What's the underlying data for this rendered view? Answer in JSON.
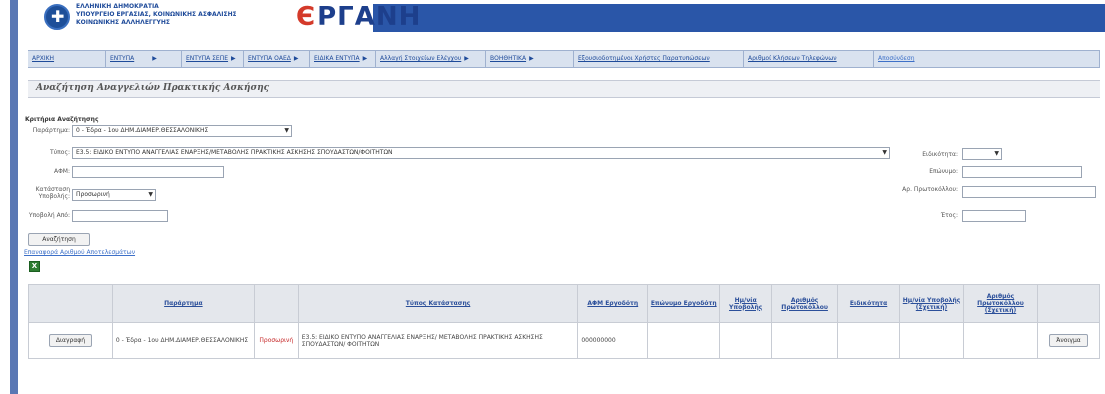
{
  "header": {
    "ministry_lines": [
      "ΕΛΛΗΝΙΚΗ ΔΗΜΟΚΡΑΤΙΑ",
      "ΥΠΟΥΡΓΕΙΟ ΕΡΓΑΣΙΑΣ, ΚΟΙΝΩΝΙΚΗΣ ΑΣΦΑΛΙΣΗΣ &",
      "ΚΟΙΝΩΝΙΚΗΣ ΑΛΛΗΛΕΓΓΥΗΣ"
    ],
    "logo_text": "ΡΓΑΝΗ",
    "logo_mark": "Є"
  },
  "menu": {
    "items": [
      {
        "label": "ΑΡΧΙΚΗ",
        "has_arrow": false
      },
      {
        "label": "ΕΝΤΥΠΑ",
        "has_arrow": true
      },
      {
        "label": "ΕΝΤΥΠΑ ΣΕΠΕ",
        "has_arrow": true
      },
      {
        "label": "ΕΝΤΥΠΑ ΟΑΕΔ",
        "has_arrow": true
      },
      {
        "label": "ΕΙΔΙΚΑ ΕΝΤΥΠΑ",
        "has_arrow": true
      },
      {
        "label": "Αλλαγή Στοιχείων Ελέγχου",
        "has_arrow": true
      },
      {
        "label": "ΒΟΗΘΗΤΙΚΑ",
        "has_arrow": true
      },
      {
        "label": "Εξουσιοδοτημένοι Χρήστες Παρατυπώσεων",
        "has_arrow": false
      },
      {
        "label": "Αριθμοί Κλήσεων Τηλεφώνων",
        "has_arrow": false
      },
      {
        "label": "Αποσύνδεση",
        "has_arrow": false
      }
    ],
    "arrow_glyph": "▶"
  },
  "page": {
    "title": "Αναζήτηση Αναγγελιών Πρακτικής Ασκήσης"
  },
  "criteria": {
    "heading": "Κριτήρια Αναζήτησης",
    "branch_label": "Παράρτημα:",
    "branch_value": "0 - Έδρα - 1ου ΔΗΜ.ΔΙΑΜΕΡ.ΘΕΣΣΑΛΟΝΙΚΗΣ",
    "type_label": "Τύπος:",
    "type_value": "Ε3.5: ΕΙΔΙΚΟ ΕΝΤΥΠΟ ΑΝΑΓΓΕΛΙΑΣ ΕΝΑΡΞΗΣ/ΜΕΤΑΒΟΛΗΣ ΠΡΑΚΤΙΚΗΣ ΑΣΚΗΣΗΣ ΣΠΟΥΔΑΣΤΩΝ/ΦΟΙΤΗΤΩΝ",
    "afm_label": "ΑΦΜ:",
    "afm_value": "",
    "status_label": "Κατάσταση Υποβολής:",
    "status_value": "Προσωρινή",
    "date_from_label": "Υποβολή Από:",
    "date_from_value": "",
    "specialty_label": "Ειδικότητα:",
    "specialty_value": "",
    "surname_label": "Επώνυμο:",
    "surname_value": "",
    "protocol_label": "Αρ. Πρωτοκόλλου:",
    "protocol_value": "",
    "year_label": "Έτος:",
    "year_value": "",
    "search_button": "Αναζήτηση",
    "clear_link": "Επαναφορά Αριθμού Αποτελεσμάτων",
    "excel_icon_glyph": "X"
  },
  "table": {
    "headers": [
      "",
      "Παράρτημα",
      "",
      "Τύπος Κατάστασης",
      "ΑΦΜ Εργοδότη",
      "Επώνυμο Εργοδότη",
      "Ημ/νία Υποβολής",
      "Αριθμός Πρωτοκόλλου",
      "Ειδικότητα",
      "Ημ/νία Υποβολής (Σχετική)",
      "Αριθμός Πρωτοκόλλου (Σχετική)",
      ""
    ],
    "rows": [
      {
        "action": "Διαγραφή",
        "branch": "0 - Έδρα - 1ου ΔΗΜ.ΔΙΑΜΕΡ.ΘΕΣΣΑΛΟΝΙΚΗΣ",
        "status": "Προσωρινή",
        "type": "Ε3.5: ΕΙΔΙΚΟ ΕΝΤΥΠΟ ΑΝΑΓΓΕΛΙΑΣ ΕΝΑΡΞΗΣ/ ΜΕΤΑΒΟΛΗΣ ΠΡΑΚΤΙΚΗΣ ΑΣΚΗΣΗΣ ΣΠΟΥΔΑΣΤΩΝ/ ΦΟΙΤΗΤΩΝ",
        "afm": "000000000",
        "employer": "",
        "date": "",
        "protocol": "",
        "specialty": "",
        "rel_date": "",
        "rel_protocol": "",
        "open": "Άνοιγμα"
      }
    ]
  },
  "colors": {
    "brand_blue": "#2a56a8",
    "menu_bg": "#d9e2ef",
    "status_red": "#c62828",
    "logo_red": "#d43a2a"
  }
}
